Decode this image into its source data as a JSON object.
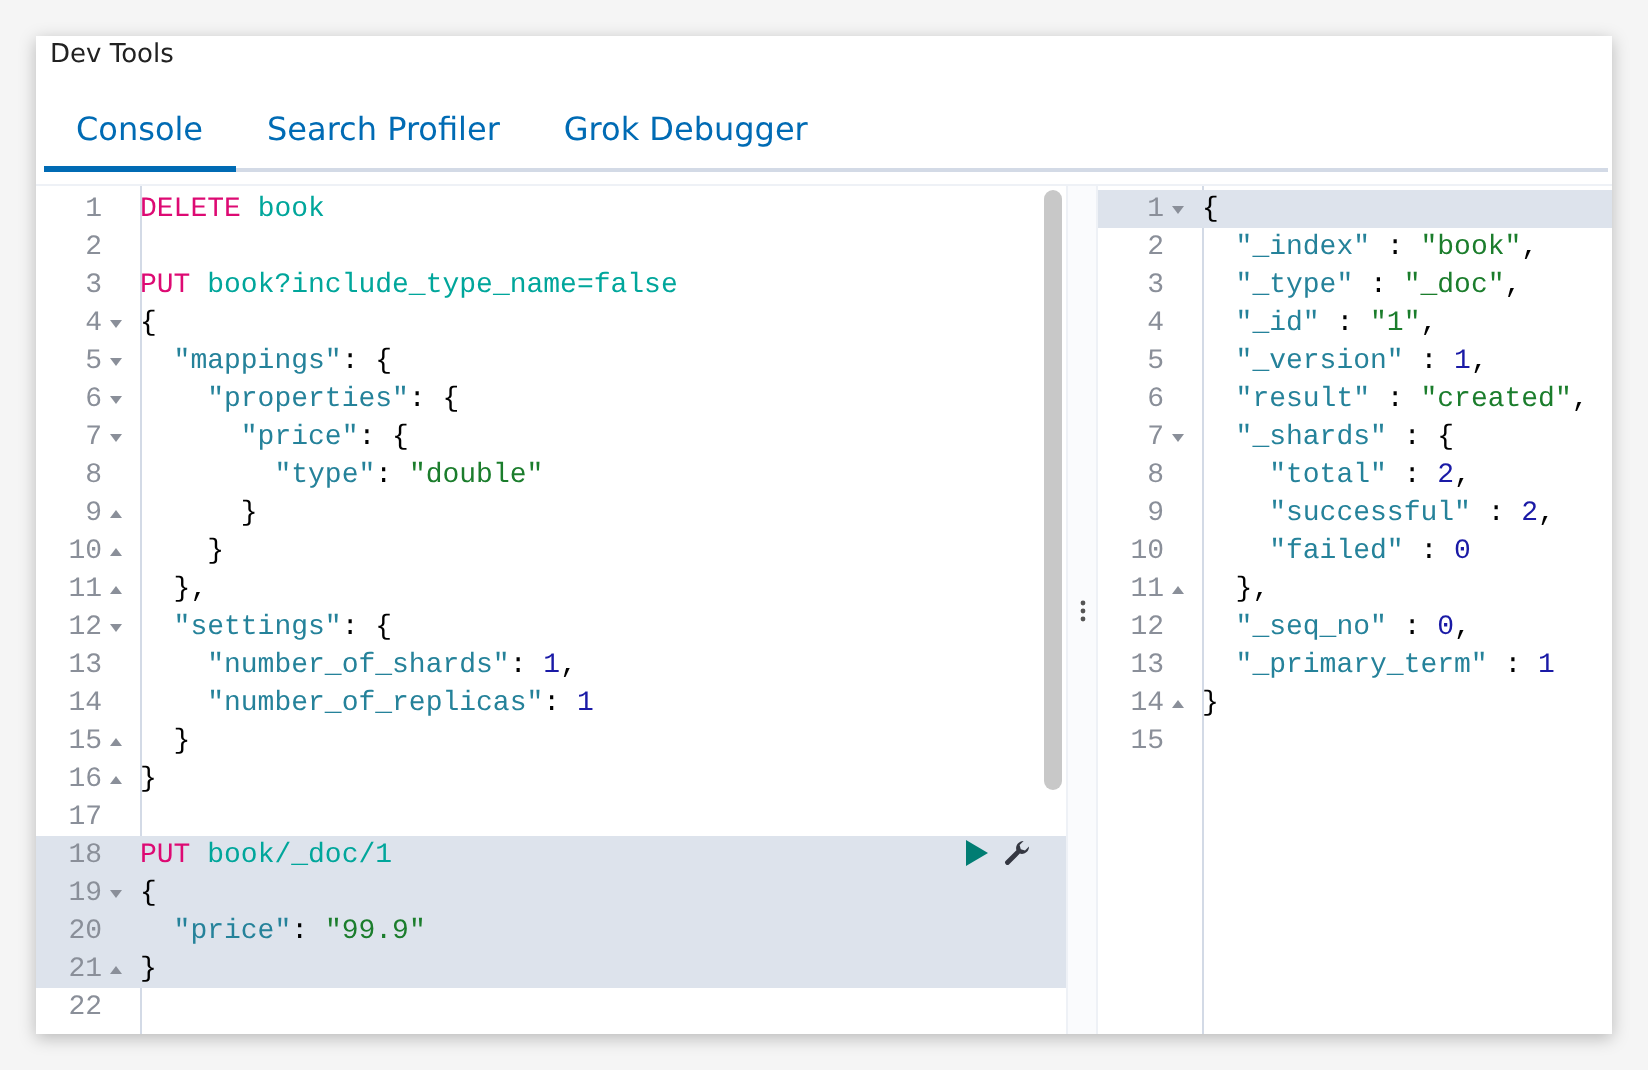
{
  "window": {
    "title": "Dev Tools"
  },
  "tabs": [
    {
      "label": "Console",
      "selected": true
    },
    {
      "label": "Search Profiler",
      "selected": false
    },
    {
      "label": "Grok Debugger",
      "selected": false
    }
  ],
  "request_editor": {
    "lines": [
      {
        "number": "1",
        "kind": "plain",
        "highlighted": false,
        "actions": false,
        "tokens": [
          {
            "kind": "method",
            "text": "DELETE"
          },
          {
            "kind": "url",
            "text": " book"
          }
        ]
      },
      {
        "number": "2",
        "kind": "plain",
        "highlighted": false,
        "actions": false
      },
      {
        "number": "3",
        "kind": "plain",
        "highlighted": false,
        "actions": false,
        "tokens": [
          {
            "kind": "method",
            "text": "PUT"
          },
          {
            "kind": "url",
            "text": " book?include_type_name=false"
          }
        ]
      },
      {
        "number": "4",
        "kind": "open",
        "highlighted": false,
        "actions": false,
        "tokens": [
          {
            "kind": "punct",
            "text": "{"
          }
        ]
      },
      {
        "number": "5",
        "kind": "open",
        "highlighted": false,
        "actions": false,
        "tokens": [
          {
            "kind": "key",
            "text": "  \"mappings\""
          },
          {
            "kind": "punct",
            "text": ": {"
          }
        ]
      },
      {
        "number": "6",
        "kind": "open",
        "highlighted": false,
        "actions": false,
        "tokens": [
          {
            "kind": "key",
            "text": "    \"properties\""
          },
          {
            "kind": "punct",
            "text": ": {"
          }
        ]
      },
      {
        "number": "7",
        "kind": "open",
        "highlighted": false,
        "actions": false,
        "tokens": [
          {
            "kind": "key",
            "text": "      \"price\""
          },
          {
            "kind": "punct",
            "text": ": {"
          }
        ]
      },
      {
        "number": "8",
        "kind": "plain",
        "highlighted": false,
        "actions": false,
        "tokens": [
          {
            "kind": "key",
            "text": "        \"type\""
          },
          {
            "kind": "punct",
            "text": ": "
          },
          {
            "kind": "string",
            "text": "\"double\""
          }
        ]
      },
      {
        "number": "9",
        "kind": "close",
        "highlighted": false,
        "actions": false,
        "tokens": [
          {
            "kind": "punct",
            "text": "      }"
          }
        ]
      },
      {
        "number": "10",
        "kind": "close",
        "highlighted": false,
        "actions": false,
        "tokens": [
          {
            "kind": "punct",
            "text": "    }"
          }
        ]
      },
      {
        "number": "11",
        "kind": "close",
        "highlighted": false,
        "actions": false,
        "tokens": [
          {
            "kind": "punct",
            "text": "  },"
          }
        ]
      },
      {
        "number": "12",
        "kind": "open",
        "highlighted": false,
        "actions": false,
        "tokens": [
          {
            "kind": "key",
            "text": "  \"settings\""
          },
          {
            "kind": "punct",
            "text": ": {"
          }
        ]
      },
      {
        "number": "13",
        "kind": "plain",
        "highlighted": false,
        "actions": false,
        "tokens": [
          {
            "kind": "key",
            "text": "    \"number_of_shards\""
          },
          {
            "kind": "punct",
            "text": ": "
          },
          {
            "kind": "number",
            "text": "1"
          },
          {
            "kind": "punct",
            "text": ","
          }
        ]
      },
      {
        "number": "14",
        "kind": "plain",
        "highlighted": false,
        "actions": false,
        "tokens": [
          {
            "kind": "key",
            "text": "    \"number_of_replicas\""
          },
          {
            "kind": "punct",
            "text": ": "
          },
          {
            "kind": "number",
            "text": "1"
          }
        ]
      },
      {
        "number": "15",
        "kind": "close",
        "highlighted": false,
        "actions": false,
        "tokens": [
          {
            "kind": "punct",
            "text": "  }"
          }
        ]
      },
      {
        "number": "16",
        "kind": "close",
        "highlighted": false,
        "actions": false,
        "tokens": [
          {
            "kind": "punct",
            "text": "}"
          }
        ]
      },
      {
        "number": "17",
        "kind": "plain",
        "highlighted": false,
        "actions": false
      },
      {
        "number": "18",
        "kind": "plain",
        "highlighted": true,
        "actions": true,
        "tokens": [
          {
            "kind": "method",
            "text": "PUT"
          },
          {
            "kind": "url",
            "text": " book/_doc/1"
          }
        ]
      },
      {
        "number": "19",
        "kind": "open",
        "highlighted": true,
        "actions": false,
        "tokens": [
          {
            "kind": "punct",
            "text": "{"
          }
        ]
      },
      {
        "number": "20",
        "kind": "plain",
        "highlighted": true,
        "actions": false,
        "tokens": [
          {
            "kind": "key",
            "text": "  \"price\""
          },
          {
            "kind": "punct",
            "text": ": "
          },
          {
            "kind": "string",
            "text": "\"99.9\""
          }
        ]
      },
      {
        "number": "21",
        "kind": "close",
        "highlighted": true,
        "actions": false,
        "tokens": [
          {
            "kind": "punct",
            "text": "}"
          }
        ]
      },
      {
        "number": "22",
        "kind": "plain",
        "highlighted": false,
        "actions": false
      }
    ]
  },
  "response_viewer": {
    "lines": [
      {
        "number": "1",
        "kind": "open",
        "highlighted": true,
        "tokens": [
          {
            "kind": "punct",
            "text": "{"
          }
        ]
      },
      {
        "number": "2",
        "kind": "plain",
        "highlighted": false,
        "tokens": [
          {
            "kind": "key",
            "text": "  \"_index\""
          },
          {
            "kind": "punct",
            "text": " : "
          },
          {
            "kind": "string",
            "text": "\"book\""
          },
          {
            "kind": "punct",
            "text": ","
          }
        ]
      },
      {
        "number": "3",
        "kind": "plain",
        "highlighted": false,
        "tokens": [
          {
            "kind": "key",
            "text": "  \"_type\""
          },
          {
            "kind": "punct",
            "text": " : "
          },
          {
            "kind": "string",
            "text": "\"_doc\""
          },
          {
            "kind": "punct",
            "text": ","
          }
        ]
      },
      {
        "number": "4",
        "kind": "plain",
        "highlighted": false,
        "tokens": [
          {
            "kind": "key",
            "text": "  \"_id\""
          },
          {
            "kind": "punct",
            "text": " : "
          },
          {
            "kind": "string",
            "text": "\"1\""
          },
          {
            "kind": "punct",
            "text": ","
          }
        ]
      },
      {
        "number": "5",
        "kind": "plain",
        "highlighted": false,
        "tokens": [
          {
            "kind": "key",
            "text": "  \"_version\""
          },
          {
            "kind": "punct",
            "text": " : "
          },
          {
            "kind": "number",
            "text": "1"
          },
          {
            "kind": "punct",
            "text": ","
          }
        ]
      },
      {
        "number": "6",
        "kind": "plain",
        "highlighted": false,
        "tokens": [
          {
            "kind": "key",
            "text": "  \"result\""
          },
          {
            "kind": "punct",
            "text": " : "
          },
          {
            "kind": "string",
            "text": "\"created\""
          },
          {
            "kind": "punct",
            "text": ","
          }
        ]
      },
      {
        "number": "7",
        "kind": "open",
        "highlighted": false,
        "tokens": [
          {
            "kind": "key",
            "text": "  \"_shards\""
          },
          {
            "kind": "punct",
            "text": " : {"
          }
        ]
      },
      {
        "number": "8",
        "kind": "plain",
        "highlighted": false,
        "tokens": [
          {
            "kind": "key",
            "text": "    \"total\""
          },
          {
            "kind": "punct",
            "text": " : "
          },
          {
            "kind": "number",
            "text": "2"
          },
          {
            "kind": "punct",
            "text": ","
          }
        ]
      },
      {
        "number": "9",
        "kind": "plain",
        "highlighted": false,
        "tokens": [
          {
            "kind": "key",
            "text": "    \"successful\""
          },
          {
            "kind": "punct",
            "text": " : "
          },
          {
            "kind": "number",
            "text": "2"
          },
          {
            "kind": "punct",
            "text": ","
          }
        ]
      },
      {
        "number": "10",
        "kind": "plain",
        "highlighted": false,
        "tokens": [
          {
            "kind": "key",
            "text": "    \"failed\""
          },
          {
            "kind": "punct",
            "text": " : "
          },
          {
            "kind": "number",
            "text": "0"
          }
        ]
      },
      {
        "number": "11",
        "kind": "close",
        "highlighted": false,
        "tokens": [
          {
            "kind": "punct",
            "text": "  },"
          }
        ]
      },
      {
        "number": "12",
        "kind": "plain",
        "highlighted": false,
        "tokens": [
          {
            "kind": "key",
            "text": "  \"_seq_no\""
          },
          {
            "kind": "punct",
            "text": " : "
          },
          {
            "kind": "number",
            "text": "0"
          },
          {
            "kind": "punct",
            "text": ","
          }
        ]
      },
      {
        "number": "13",
        "kind": "plain",
        "highlighted": false,
        "tokens": [
          {
            "kind": "key",
            "text": "  \"_primary_term\""
          },
          {
            "kind": "punct",
            "text": " : "
          },
          {
            "kind": "number",
            "text": "1"
          }
        ]
      },
      {
        "number": "14",
        "kind": "close",
        "highlighted": false,
        "tokens": [
          {
            "kind": "punct",
            "text": "}"
          }
        ]
      },
      {
        "number": "15",
        "kind": "plain",
        "highlighted": false
      }
    ]
  }
}
